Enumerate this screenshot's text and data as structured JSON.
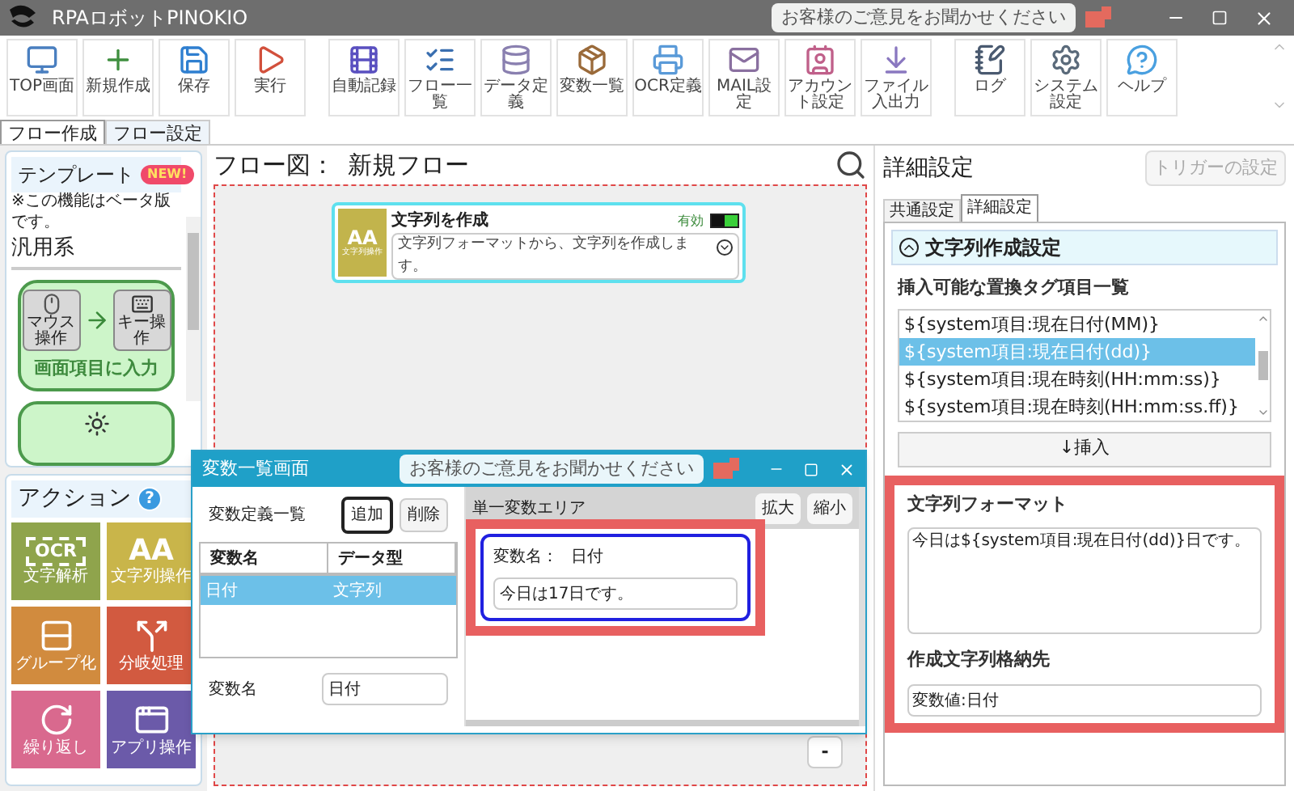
{
  "window": {
    "title": "RPAロボットPINOKIO",
    "feedback": "お客様のご意見をお聞かせください"
  },
  "toolbar_groups": [
    {
      "buttons": [
        {
          "label": "TOP画面",
          "kind": "top"
        },
        {
          "label": "新規作成",
          "kind": "new"
        },
        {
          "label": "保存",
          "kind": "save"
        },
        {
          "label": "実行",
          "kind": "run"
        }
      ]
    },
    {
      "buttons": [
        {
          "label": "自動記録",
          "kind": "record"
        },
        {
          "label": "フロー一覧",
          "kind": "flowlist"
        },
        {
          "label": "データ定義",
          "kind": "data"
        },
        {
          "label": "変数一覧",
          "kind": "variables"
        },
        {
          "label": "OCR定義",
          "kind": "ocr"
        },
        {
          "label": "MAIL設定",
          "kind": "mail"
        },
        {
          "label": "アカウント設定",
          "kind": "account"
        },
        {
          "label": "ファイル入出力",
          "kind": "file"
        }
      ]
    },
    {
      "buttons": [
        {
          "label": "ログ",
          "kind": "log"
        },
        {
          "label": "システム設定",
          "kind": "settings"
        },
        {
          "label": "ヘルプ",
          "kind": "help"
        }
      ]
    }
  ],
  "mode_tabs": [
    {
      "label": "フロー作成",
      "selected": true
    },
    {
      "label": "フロー設定",
      "selected": false
    }
  ],
  "template_panel": {
    "title": "テンプレート",
    "badge": "NEW!",
    "note": "※この機能はベータ版です。",
    "category": "汎用系",
    "cards": [
      {
        "kind": "full",
        "title": "画面項目に入力",
        "from_label": "マウス操作",
        "to_label": "キー操作"
      },
      {
        "kind": "partial"
      }
    ]
  },
  "action_panel": {
    "title": "アクション",
    "help": "?",
    "tiles": [
      {
        "label": "文字解析",
        "kind": "ocr",
        "icon_text": "OCR",
        "color": "#8fa44c"
      },
      {
        "label": "文字列操作",
        "kind": "text",
        "icon_text": "AA",
        "color": "#c9b54a"
      },
      {
        "label": "グループ化",
        "kind": "group",
        "color": "#d18b3e"
      },
      {
        "label": "分岐処理",
        "kind": "branch",
        "color": "#d25a40"
      },
      {
        "label": "繰り返し",
        "kind": "loop",
        "color": "#d9698e"
      },
      {
        "label": "アプリ操作",
        "kind": "app",
        "color": "#6b5aa9"
      }
    ]
  },
  "flow": {
    "title": "フロー図：",
    "name": "新規フロー",
    "zoom_out": "-",
    "nodes": [
      {
        "title": "文字列を作成",
        "category": "文字列操作",
        "icon_text": "AA",
        "status": "有効",
        "enabled": true,
        "description": "文字列フォーマットから、文字列を作成します。"
      }
    ]
  },
  "details": {
    "title": "詳細設定",
    "trigger_button": "トリガーの設定",
    "tabs": [
      {
        "label": "共通設定",
        "selected": false
      },
      {
        "label": "詳細設定",
        "selected": true
      }
    ],
    "section": {
      "title": "文字列作成設定",
      "expanded": true
    },
    "tag_list_label": "挿入可能な置換タグ項目一覧",
    "tags": [
      {
        "label": "${system項目:現在日付(MM)}",
        "selected": false
      },
      {
        "label": "${system項目:現在日付(dd)}",
        "selected": true
      },
      {
        "label": "${system項目:現在時刻(HH:mm:ss)}",
        "selected": false
      },
      {
        "label": "${system項目:現在時刻(HH:mm:ss.ff)}",
        "selected": false
      }
    ],
    "insert_button": "↓挿入",
    "format_label": "文字列フォーマット",
    "format_value": "今日は${system項目:現在日付(dd)}日です。",
    "target_label": "作成文字列格納先",
    "target_value": "変数値:日付"
  },
  "variables_dialog": {
    "title": "変数一覧画面",
    "feedback": "お客様のご意見をお聞かせください",
    "list_label": "変数定義一覧",
    "add_button": "追加",
    "delete_button": "削除",
    "columns": [
      "変数名",
      "データ型"
    ],
    "rows": [
      {
        "cells": [
          "日付",
          "文字列"
        ],
        "selected": true
      }
    ],
    "name_label": "変数名",
    "name_value": "日付",
    "area_title": "単一変数エリア",
    "zoom_in_button": "拡大",
    "zoom_out_button": "縮小",
    "card": {
      "label": "変数名：",
      "name": "日付",
      "value": "今日は17日です。"
    }
  }
}
